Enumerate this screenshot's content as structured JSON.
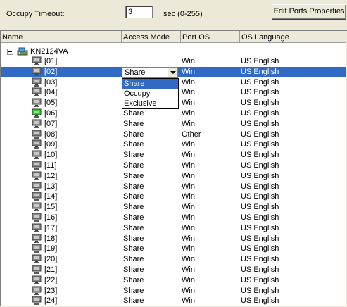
{
  "settings": {
    "timeout_label": "Occupy Timeout:",
    "timeout_value": "3",
    "timeout_unit": "sec (0-255)",
    "edit_button": "Edit Ports Properties"
  },
  "columns": [
    "Name",
    "Access Mode",
    "Port OS",
    "OS Language"
  ],
  "root": {
    "label": "KN2124VA"
  },
  "ports": [
    {
      "name": "[01]",
      "mode": "",
      "os": "Win",
      "lang": "US English",
      "icon": "pc-icon-gray"
    },
    {
      "name": "[02]",
      "mode": "",
      "os": "Win",
      "lang": "US English",
      "icon": "pc-icon-gray",
      "selected": true
    },
    {
      "name": "[03]",
      "mode": "",
      "os": "Win",
      "lang": "US English",
      "icon": "pc-icon-gray"
    },
    {
      "name": "[04]",
      "mode": "",
      "os": "Win",
      "lang": "US English",
      "icon": "pc-icon-gray"
    },
    {
      "name": "[05]",
      "mode": "",
      "os": "Win",
      "lang": "US English",
      "icon": "pc-icon-gray"
    },
    {
      "name": "[06]",
      "mode": "Share",
      "os": "Win",
      "lang": "US English",
      "icon": "pc-icon-green"
    },
    {
      "name": "[07]",
      "mode": "Share",
      "os": "Win",
      "lang": "US English",
      "icon": "pc-icon-gray"
    },
    {
      "name": "[08]",
      "mode": "Share",
      "os": "Other",
      "lang": "US English",
      "icon": "pc-icon-gray"
    },
    {
      "name": "[09]",
      "mode": "Share",
      "os": "Win",
      "lang": "US English",
      "icon": "pc-icon-gray"
    },
    {
      "name": "[10]",
      "mode": "Share",
      "os": "Win",
      "lang": "US English",
      "icon": "pc-icon-gray"
    },
    {
      "name": "[11]",
      "mode": "Share",
      "os": "Win",
      "lang": "US English",
      "icon": "pc-icon-gray"
    },
    {
      "name": "[12]",
      "mode": "Share",
      "os": "Win",
      "lang": "US English",
      "icon": "pc-icon-gray"
    },
    {
      "name": "[13]",
      "mode": "Share",
      "os": "Win",
      "lang": "US English",
      "icon": "pc-icon-gray"
    },
    {
      "name": "[14]",
      "mode": "Share",
      "os": "Win",
      "lang": "US English",
      "icon": "pc-icon-gray"
    },
    {
      "name": "[15]",
      "mode": "Share",
      "os": "Win",
      "lang": "US English",
      "icon": "pc-icon-gray"
    },
    {
      "name": "[16]",
      "mode": "Share",
      "os": "Win",
      "lang": "US English",
      "icon": "pc-icon-gray"
    },
    {
      "name": "[17]",
      "mode": "Share",
      "os": "Win",
      "lang": "US English",
      "icon": "pc-icon-gray"
    },
    {
      "name": "[18]",
      "mode": "Share",
      "os": "Win",
      "lang": "US English",
      "icon": "pc-icon-gray"
    },
    {
      "name": "[19]",
      "mode": "Share",
      "os": "Win",
      "lang": "US English",
      "icon": "pc-icon-gray"
    },
    {
      "name": "[20]",
      "mode": "Share",
      "os": "Win",
      "lang": "US English",
      "icon": "pc-icon-gray"
    },
    {
      "name": "[21]",
      "mode": "Share",
      "os": "Win",
      "lang": "US English",
      "icon": "pc-icon-gray"
    },
    {
      "name": "[22]",
      "mode": "Share",
      "os": "Win",
      "lang": "US English",
      "icon": "pc-icon-gray"
    },
    {
      "name": "[23]",
      "mode": "Share",
      "os": "Win",
      "lang": "US English",
      "icon": "pc-icon-gray"
    },
    {
      "name": "[24]",
      "mode": "Share",
      "os": "Win",
      "lang": "US English",
      "icon": "pc-icon-gray"
    }
  ],
  "combo": {
    "value": "Share",
    "options": [
      "Share",
      "Occupy",
      "Exclusive"
    ],
    "highlighted": "Share"
  },
  "colors": {
    "selection": "#316ac5",
    "window_bg": "#ece9d8"
  }
}
